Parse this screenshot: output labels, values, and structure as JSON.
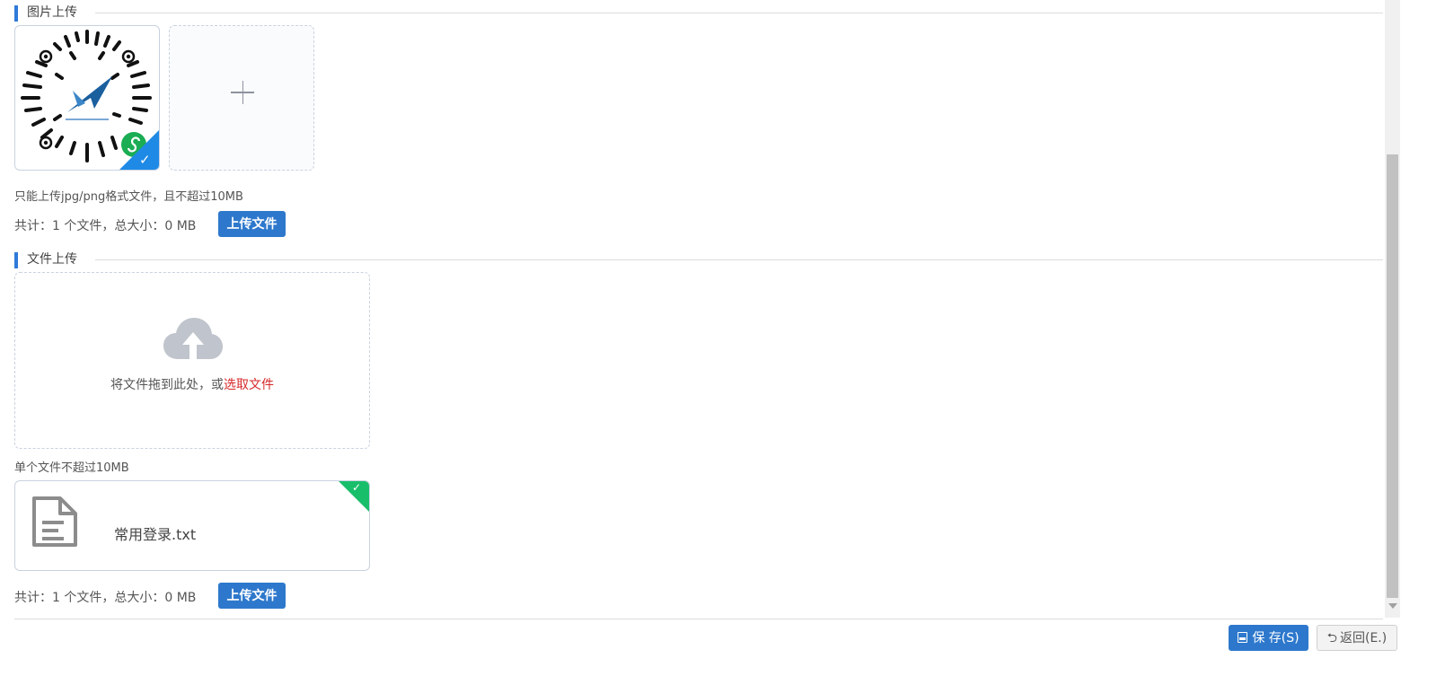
{
  "image_section": {
    "title": "图片上传",
    "hint": "只能上传jpg/png格式文件，且不超过10MB",
    "total": "共计：1 个文件，总大小：0 MB",
    "upload_button": "上传文件",
    "add_icon": "plus-icon"
  },
  "file_section": {
    "title": "文件上传",
    "drop_text": "将文件拖到此处，或",
    "drop_link": "选取文件",
    "hint": "单个文件不超过10MB",
    "file_name": "常用登录.txt",
    "total": "共计：1 个文件，总大小：0 MB",
    "upload_button": "上传文件"
  },
  "footer": {
    "save_label": "保 存(S)",
    "back_label": "返回(E.)"
  },
  "colors": {
    "accent": "#2d78cc",
    "success": "#19be6b",
    "link_red": "#d62a2a"
  }
}
